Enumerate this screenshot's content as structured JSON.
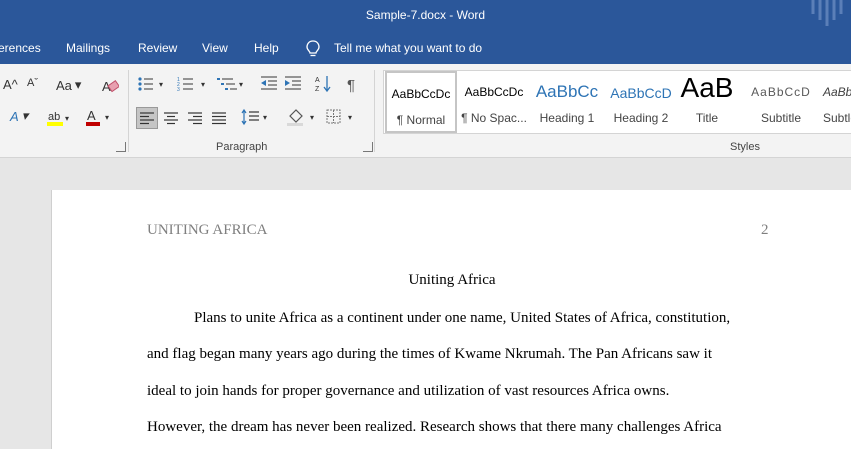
{
  "window": {
    "title": "Sample-7.docx  -  Word"
  },
  "menu": {
    "tabs": [
      {
        "label": "erences"
      },
      {
        "label": "Mailings"
      },
      {
        "label": "Review"
      },
      {
        "label": "View"
      },
      {
        "label": "Help"
      }
    ],
    "tell_me": "Tell me what you want to do"
  },
  "ribbon": {
    "paragraph_label": "Paragraph",
    "styles_label": "Styles",
    "font_buttons": {
      "grow": "A",
      "shrink": "A",
      "change_case": "Aa",
      "text_effects": "A",
      "font_color": "A"
    },
    "styles": [
      {
        "sample": "AaBbCcDc",
        "name": "¶ Normal",
        "active": true
      },
      {
        "sample": "AaBbCcDc",
        "name": "¶ No Spac..."
      },
      {
        "sample": "AaBbCc",
        "name": "Heading 1"
      },
      {
        "sample": "AaBbCcD",
        "name": "Heading 2"
      },
      {
        "sample": "AaB",
        "name": "Title"
      },
      {
        "sample": "AaBbCcD",
        "name": "Subtitle"
      },
      {
        "sample": "AaBbCcD",
        "name": "Subtle"
      }
    ]
  },
  "document": {
    "header_left": "UNITING AFRICA",
    "header_right": "2",
    "title": "Uniting Africa",
    "lines": [
      "Plans to unite Africa as a continent under one name, United States of Africa, constitution,",
      "and flag began many years ago during the times of Kwame Nkrumah. The Pan Africans saw it",
      "ideal to join hands for proper governance and utilization of vast resources Africa owns.",
      "However, the dream has never been realized. Research shows that there many challenges Africa"
    ]
  },
  "colors": {
    "title_bar": "#2b579a",
    "ribbon_bg": "#f3f3f3",
    "canvas_bg": "#e6e6e6",
    "heading_blue": "#2e74b5",
    "highlight_yellow": "#ffff00",
    "font_red": "#c00000"
  }
}
